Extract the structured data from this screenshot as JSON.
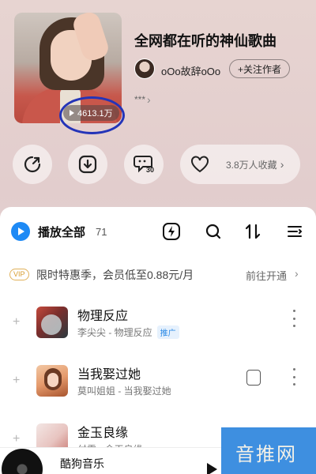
{
  "playlist": {
    "title": "全网都在听的神仙歌曲",
    "play_count": "4613.1万",
    "author_name": "oOo故辞oOo",
    "follow_label": "+关注作者",
    "description": "***"
  },
  "actions": {
    "share_icon": "share-icon",
    "download_icon": "download-icon",
    "comment_icon": "comment-icon",
    "comment_count": "30",
    "collect_label": "3.8万人收藏"
  },
  "toolbar": {
    "play_all_label": "播放全部",
    "song_count": "71",
    "icons": [
      "flash-icon",
      "search-icon",
      "sort-icon",
      "menu-icon"
    ]
  },
  "vip": {
    "badge": "VIP",
    "text": "限时特惠季，会员低至0.88元/月",
    "link": "前往开通"
  },
  "songs": [
    {
      "title": "物理反应",
      "meta": "李尖尖 - 物理反应",
      "tag": "推广"
    },
    {
      "title": "当我娶过她",
      "meta": "莫叫姐姐 - 当我娶过她"
    },
    {
      "title": "金玉良缘",
      "meta": "付雪 - 金玉良缘"
    }
  ],
  "player": {
    "title": "酷狗音乐"
  },
  "watermark": "音推网",
  "colors": {
    "accent": "#1e8af5",
    "annotation": "#2434b8",
    "vip": "#d79c2e"
  }
}
